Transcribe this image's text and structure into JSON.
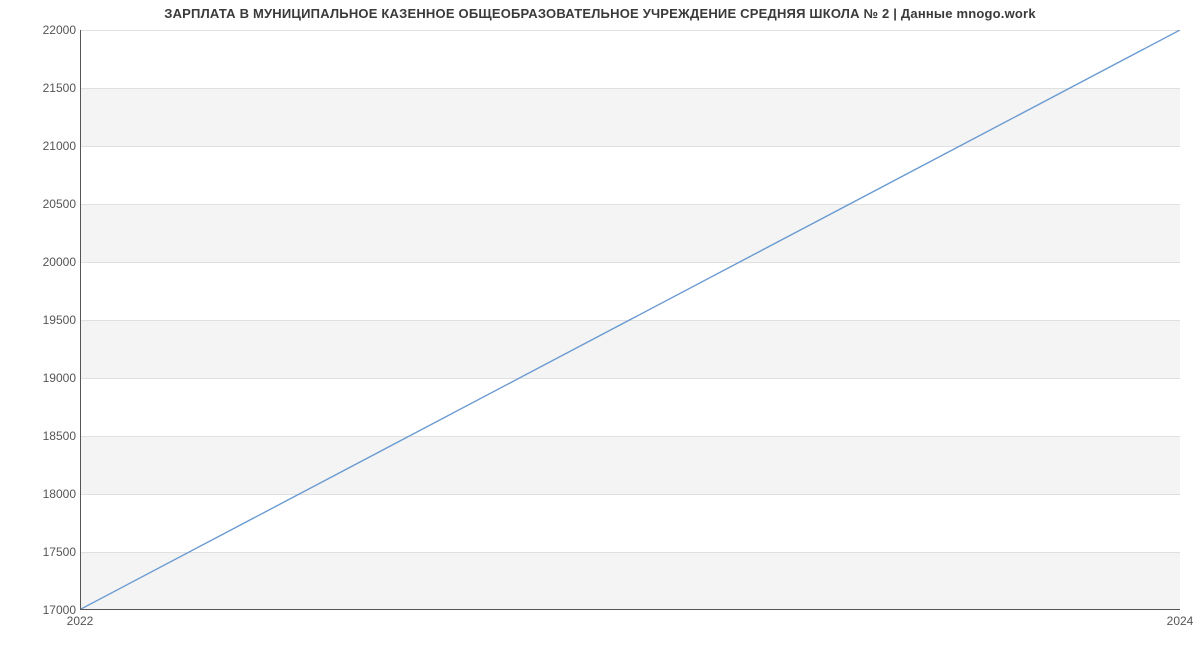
{
  "chart_data": {
    "type": "line",
    "title": "ЗАРПЛАТА В МУНИЦИПАЛЬНОЕ КАЗЕННОЕ ОБЩЕОБРАЗОВАТЕЛЬНОЕ УЧРЕЖДЕНИЕ СРЕДНЯЯ ШКОЛА № 2 | Данные mnogo.work",
    "x": [
      2022,
      2024
    ],
    "values": [
      17000,
      22000
    ],
    "xlabel": "",
    "ylabel": "",
    "xlim": [
      2022,
      2024
    ],
    "ylim": [
      17000,
      22000
    ],
    "y_ticks": [
      17000,
      17500,
      18000,
      18500,
      19000,
      19500,
      20000,
      20500,
      21000,
      21500,
      22000
    ],
    "x_ticks": [
      2022,
      2024
    ],
    "line_color": "#6b9bd1",
    "grid": true
  }
}
